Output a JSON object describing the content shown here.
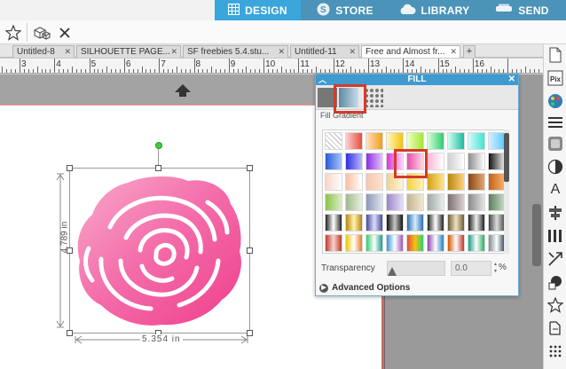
{
  "nav": {
    "tabs": [
      {
        "label": "DESIGN",
        "icon": "grid-icon",
        "active": true
      },
      {
        "label": "STORE",
        "icon": "silhouette-s-icon"
      },
      {
        "label": "LIBRARY",
        "icon": "cloud-icon"
      },
      {
        "label": "SEND",
        "icon": "machine-icon"
      }
    ]
  },
  "doc_tabs": [
    {
      "label": "Untitled-8"
    },
    {
      "label": "SILHOUETTE PAGE..."
    },
    {
      "label": "SF freebies 5.4.stu..."
    },
    {
      "label": "Untitled-11"
    },
    {
      "label": "Free and Almost fr..."
    },
    {
      "label": "+"
    }
  ],
  "ruler": {
    "labels": [
      "3",
      "4",
      "5",
      "6",
      "7",
      "8",
      "9",
      "10",
      "11",
      "12",
      "13",
      "14",
      "15",
      "16"
    ]
  },
  "selection": {
    "height_label": "4.789 in",
    "width_label": "5.354 in"
  },
  "fill_panel": {
    "title": "FILL",
    "subtitle": "Fill Gradient",
    "transparency_label": "Transparency",
    "transparency_value": "0.0",
    "transparency_unit": "%",
    "advanced_label": "Advanced Options"
  },
  "colors": {
    "accent": "#3aa6dc",
    "selection_red": "#d63a2a",
    "rose": "#f4569c"
  }
}
